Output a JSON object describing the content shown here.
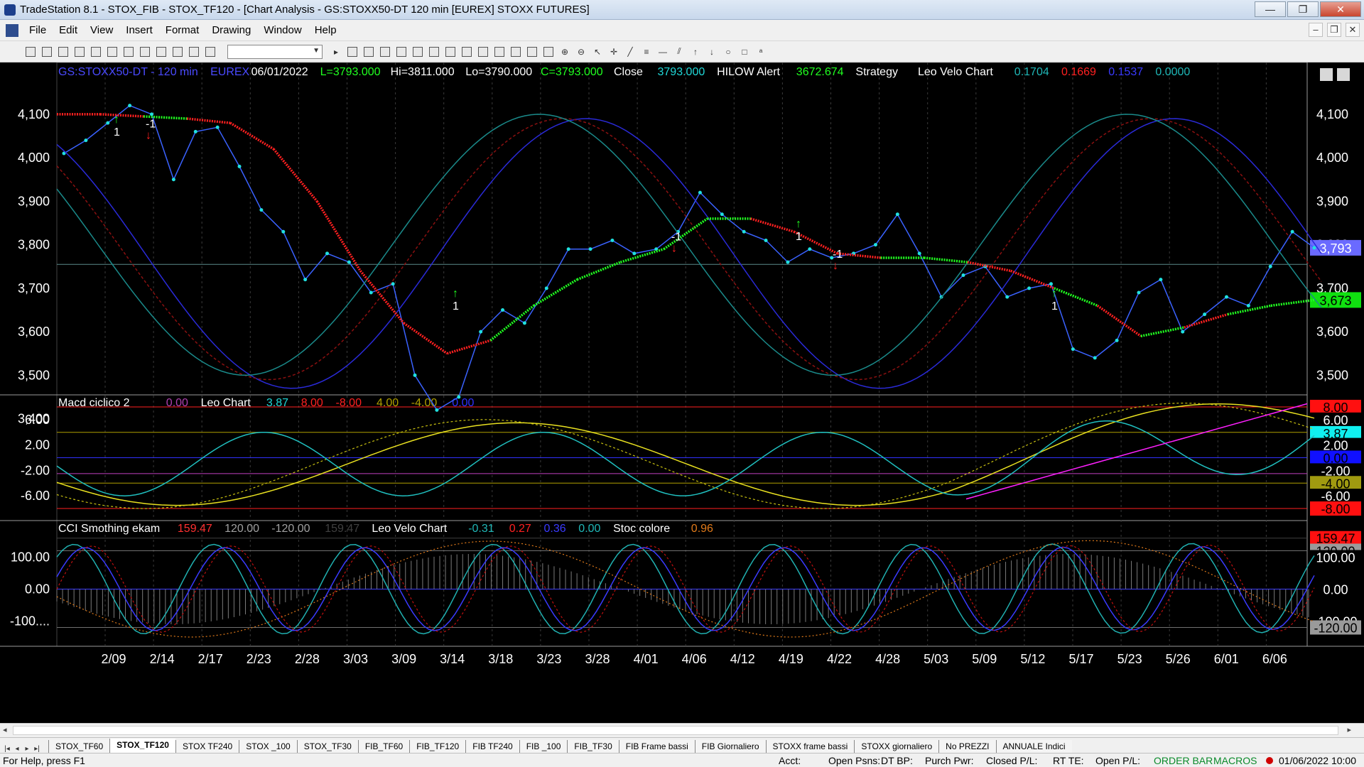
{
  "window": {
    "title": "TradeStation 8.1 - STOX_FIB - STOX_TF120 - [Chart Analysis - GS:STOXX50-DT  120 min  [EUREX] STOXX FUTURES]",
    "minimize": "—",
    "maximize": "❐",
    "close": "✕"
  },
  "menu": {
    "items": [
      "File",
      "Edit",
      "View",
      "Insert",
      "Format",
      "Drawing",
      "Window",
      "Help"
    ],
    "mdi_minimize": "–",
    "mdi_restore": "❐",
    "mdi_close": "✕"
  },
  "toolbar": {
    "symbol_value": ""
  },
  "price_panel": {
    "symbol": "GS:STOXX50-DT - 120 min",
    "exchange": "EUREX",
    "date": "06/01/2022",
    "last": "L=3793.000",
    "high": "Hi=3811.000",
    "low": "Lo=3790.000",
    "close": "C=3793.000",
    "close_label": "Close",
    "close_value": "3793.000",
    "hilow_label": "HILOW Alert",
    "hilow_value": "3672.674",
    "strategy_label": "Strategy",
    "velo_label": "Leo Velo Chart",
    "velo_values": [
      "0.1704",
      "0.1669",
      "0.1537",
      "0.0000"
    ],
    "velo_colors": [
      "#1fb7b7",
      "#ff2020",
      "#3a3aff",
      "#1fb7b7"
    ],
    "axis_ticks": [
      "4,100",
      "4,000",
      "3,900",
      "3,800",
      "3,700",
      "3,600",
      "3,500",
      "3,400"
    ],
    "price_badge": "3,793",
    "hilow_badge": "3,673",
    "markers": [
      "1",
      "-1",
      "1",
      "-1",
      "1",
      "-1",
      "1"
    ]
  },
  "macd_panel": {
    "name": "Macd ciclico 2",
    "values": [
      {
        "text": "0.00",
        "color": "#b040b0"
      },
      {
        "text": "Leo Chart",
        "color": "#ffffff"
      },
      {
        "text": "3.87",
        "color": "#1fd8d8"
      },
      {
        "text": "8.00",
        "color": "#ff2020"
      },
      {
        "text": "-8.00",
        "color": "#ff2020"
      },
      {
        "text": "4.00",
        "color": "#b0a000"
      },
      {
        "text": "-4.00",
        "color": "#b0a000"
      },
      {
        "text": "0.00",
        "color": "#3030ff"
      }
    ],
    "axis_ticks": [
      "6.00",
      "2.00",
      "-2.00",
      "-6.00"
    ],
    "badges": [
      {
        "text": "8.00",
        "bg": "#ff1010",
        "fg": "#000000"
      },
      {
        "text": "6.00",
        "bg": "#000000",
        "fg": "#ffffff"
      },
      {
        "text": "3.87",
        "bg": "#10f0f0",
        "fg": "#000000"
      },
      {
        "text": "2.00",
        "bg": "#000000",
        "fg": "#ffffff"
      },
      {
        "text": "0.00",
        "bg": "#1010ff",
        "fg": "#000000"
      },
      {
        "text": "-2.00",
        "bg": "#000000",
        "fg": "#ffffff"
      },
      {
        "text": "-4.00",
        "bg": "#a09a10",
        "fg": "#000000"
      },
      {
        "text": "-6.00",
        "bg": "#000000",
        "fg": "#ffffff"
      },
      {
        "text": "-8.00",
        "bg": "#ff1010",
        "fg": "#000000"
      }
    ]
  },
  "cci_panel": {
    "name": "CCI Smothing ekam",
    "values": [
      {
        "text": "159.47",
        "color": "#ff3030"
      },
      {
        "text": "120.00",
        "color": "#a0a0a0"
      },
      {
        "text": "-120.00",
        "color": "#a0a0a0"
      },
      {
        "text": "159.47",
        "color": "#404040"
      },
      {
        "text": "Leo Velo Chart",
        "color": "#ffffff"
      },
      {
        "text": "-0.31",
        "color": "#1fb7b7"
      },
      {
        "text": "0.27",
        "color": "#ff2020"
      },
      {
        "text": "0.36",
        "color": "#3a3aff"
      },
      {
        "text": "0.00",
        "color": "#1fb7b7"
      },
      {
        "text": "Stoc colore",
        "color": "#ffffff"
      },
      {
        "text": "0.96",
        "color": "#e07a1a"
      }
    ],
    "axis_ticks": [
      "100.00",
      "0.00",
      "-100...."
    ],
    "badges": [
      {
        "text": "159.47",
        "bg": "#ff1010",
        "fg": "#000000"
      },
      {
        "text": "120.00",
        "bg": "#9a9a9a",
        "fg": "#000000"
      },
      {
        "text": "100.00",
        "bg": "#000000",
        "fg": "#ffffff"
      },
      {
        "text": "0.00",
        "bg": "#000000",
        "fg": "#ffffff"
      },
      {
        "text": "-100.00",
        "bg": "#000000",
        "fg": "#ffffff"
      },
      {
        "text": "-120.00",
        "bg": "#9a9a9a",
        "fg": "#000000"
      }
    ]
  },
  "time_axis": {
    "labels": [
      "2/09",
      "2/14",
      "2/17",
      "2/23",
      "2/28",
      "3/03",
      "3/09",
      "3/14",
      "3/18",
      "3/23",
      "3/28",
      "4/01",
      "4/06",
      "4/12",
      "4/19",
      "4/22",
      "4/28",
      "5/03",
      "5/09",
      "5/12",
      "5/17",
      "5/23",
      "5/26",
      "6/01",
      "6/06"
    ]
  },
  "tabs": [
    "STOX_TF60",
    "STOX_TF120",
    "STOX TF240",
    "STOX _100",
    "STOX_TF30",
    "FIB_TF60",
    "FIB_TF120",
    "FIB TF240",
    "FIB _100",
    "FIB_TF30",
    "FIB Frame bassi",
    "FIB Giornaliero",
    "STOXX frame bassi",
    "STOXX giornaliero",
    "No PREZZI",
    "ANNUALE Indici"
  ],
  "active_tab": "STOX_TF120",
  "status": {
    "help": "For Help, press F1",
    "acct": "Acct:",
    "open_psns": "Open Psns:",
    "dt_bp": "DT BP:",
    "purch_pwr": "Purch Pwr:",
    "closed_pl": "Closed P/L:",
    "rt_te": "RT TE:",
    "open_pl": "Open P/L:",
    "order_bar": "ORDER BAR",
    "macros": "MACROS",
    "datetime": "01/06/2022 10:00"
  },
  "chart_data": {
    "type": "line",
    "series": [
      {
        "name": "Close",
        "values": [
          4010,
          4040,
          4080,
          4120,
          4100,
          3950,
          4060,
          4070,
          3980,
          3880,
          3830,
          3720,
          3780,
          3760,
          3690,
          3710,
          3500,
          3420,
          3450,
          3600,
          3650,
          3620,
          3700,
          3790,
          3790,
          3810,
          3780,
          3790,
          3830,
          3920,
          3870,
          3830,
          3810,
          3760,
          3790,
          3770,
          3780,
          3800,
          3870,
          3780,
          3680,
          3730,
          3750,
          3680,
          3700,
          3710,
          3560,
          3540,
          3580,
          3690,
          3720,
          3600,
          3640,
          3680,
          3660,
          3750,
          3830,
          3793
        ]
      },
      {
        "name": "HILOW Alert",
        "values": [
          4100,
          4100,
          4095,
          4090,
          4080,
          4020,
          3900,
          3740,
          3620,
          3550,
          3580,
          3660,
          3720,
          3760,
          3790,
          3860,
          3860,
          3830,
          3780,
          3770,
          3770,
          3760,
          3740,
          3700,
          3660,
          3590,
          3610,
          3640,
          3660,
          3673
        ]
      }
    ],
    "x": [
      "2/09",
      "2/14",
      "2/17",
      "2/23",
      "2/28",
      "3/03",
      "3/09",
      "3/14",
      "3/18",
      "3/23",
      "3/28",
      "4/01",
      "4/06",
      "4/12",
      "4/19",
      "4/22",
      "4/28",
      "5/03",
      "5/09",
      "5/12",
      "5/17",
      "5/23",
      "5/26",
      "6/01"
    ],
    "ylim": [
      3370,
      4170
    ],
    "grid": false
  }
}
